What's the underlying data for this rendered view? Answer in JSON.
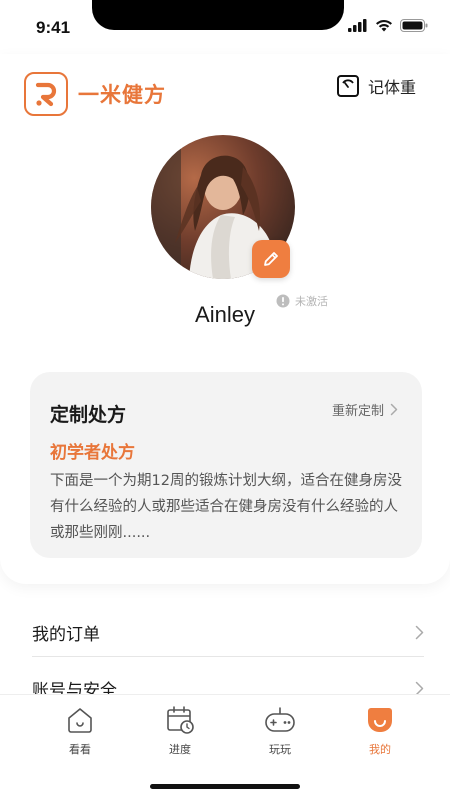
{
  "status_bar": {
    "time": "9:41"
  },
  "brand": {
    "name": "一米健方"
  },
  "header": {
    "weigh_label": "记体重"
  },
  "profile": {
    "username": "Ainley",
    "status": "未激活"
  },
  "prescription": {
    "title": "定制处方",
    "action_label": "重新定制",
    "subtitle": "初学者处方",
    "description": "下面是一个为期12周的锻炼计划大纲，适合在健身房没有什么经验的人或那些适合在健身房没有什么经验的人或那些刚刚......"
  },
  "menu": {
    "items": [
      {
        "label": "我的订单"
      },
      {
        "label": "账号与安全"
      }
    ]
  },
  "tabbar": {
    "tabs": [
      {
        "label": "看看",
        "icon": "house-icon",
        "active": false
      },
      {
        "label": "进度",
        "icon": "calendar-clock-icon",
        "active": false
      },
      {
        "label": "玩玩",
        "icon": "gamepad-icon",
        "active": false
      },
      {
        "label": "我的",
        "icon": "profile-icon",
        "active": true
      }
    ]
  },
  "colors": {
    "accent": "#e8763a",
    "card_bg": "#f3f3f3",
    "text": "#1a1a1a"
  }
}
